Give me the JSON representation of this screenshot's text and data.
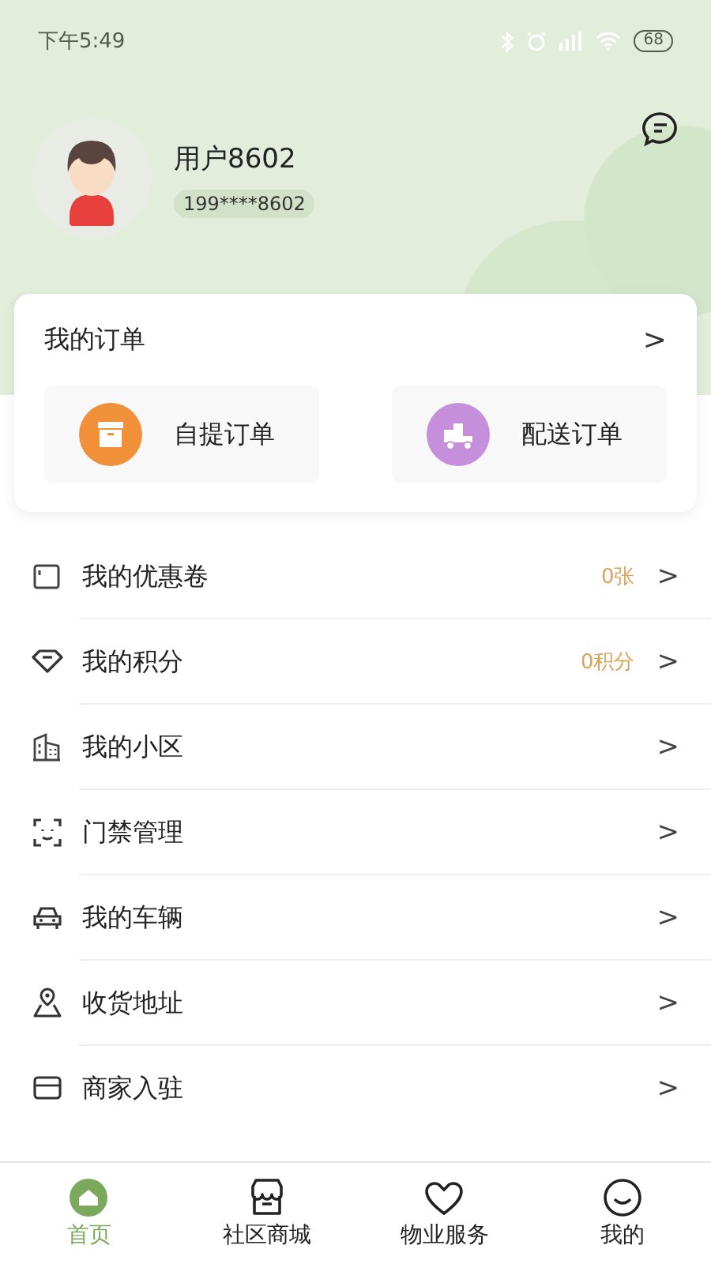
{
  "status_bar": {
    "time": "下午5:49",
    "battery": "68"
  },
  "profile": {
    "name": "用户8602",
    "phone": "199****8602"
  },
  "orders": {
    "title": "我的订单",
    "chevron": ">",
    "types": [
      {
        "label": "自提订单",
        "color": "#f0913a"
      },
      {
        "label": "配送订单",
        "color": "#c58fdc"
      }
    ]
  },
  "menu": [
    {
      "label": "我的优惠卷",
      "value": "0张",
      "chevron": ">"
    },
    {
      "label": "我的积分",
      "value": "0积分",
      "chevron": ">"
    },
    {
      "label": "我的小区",
      "chevron": ">"
    },
    {
      "label": "门禁管理",
      "chevron": ">"
    },
    {
      "label": "我的车辆",
      "chevron": ">"
    },
    {
      "label": "收货地址",
      "chevron": ">"
    },
    {
      "label": "商家入驻",
      "chevron": ">"
    }
  ],
  "tabs": [
    {
      "label": "首页",
      "selected": true
    },
    {
      "label": "社区商城",
      "selected": false
    },
    {
      "label": "物业服务",
      "selected": false
    },
    {
      "label": "我的",
      "selected": false
    }
  ]
}
